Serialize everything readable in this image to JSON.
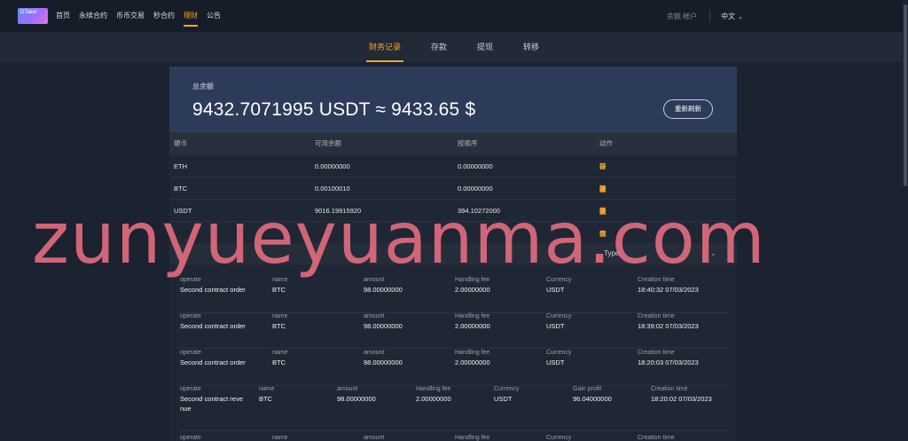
{
  "nav": {
    "logo": "DTaker",
    "links": [
      "首页",
      "永续合约",
      "币币交易",
      "秒合约",
      "理财",
      "公告"
    ],
    "account": "余额 帐户",
    "language": "中文"
  },
  "subtabs": [
    "财务记录",
    "存款",
    "提现",
    "转移"
  ],
  "balance": {
    "label": "总余额",
    "value": "9432.7071995 USDT ≈ 9433.65 $",
    "refresh": "重新刷新"
  },
  "assets": {
    "headers": [
      "硬币",
      "可用余额",
      "按顺序",
      "动作"
    ],
    "rows": [
      {
        "coin": "ETH",
        "available": "0.00000000",
        "in_order": "0.00000000"
      },
      {
        "coin": "BTC",
        "available": "0.00100010",
        "in_order": "0.00000000"
      },
      {
        "coin": "USDT",
        "available": "9016.19915920",
        "in_order": "394.10272000"
      }
    ],
    "actions": [
      "提现",
      "存款",
      "转移"
    ]
  },
  "filter": {
    "type_label": "Type"
  },
  "records_labels": {
    "operate": "operate",
    "name": "name",
    "amount": "amount",
    "fee": "Handling fee",
    "currency": "Currency",
    "profit": "Gain profit",
    "time": "Creation time"
  },
  "records": [
    {
      "operate": "Second contract order",
      "name": "BTC",
      "amount": "98.00000000",
      "fee": "2.00000000",
      "currency": "USDT",
      "time": "18:40:32 07/03/2023"
    },
    {
      "operate": "Second contract order",
      "name": "BTC",
      "amount": "98.00000000",
      "fee": "2.00000000",
      "currency": "USDT",
      "time": "18:39:02 07/03/2023"
    },
    {
      "operate": "Second contract order",
      "name": "BTC",
      "amount": "98.00000000",
      "fee": "2.00000000",
      "currency": "USDT",
      "time": "18:20:03 07/03/2023"
    },
    {
      "operate_line1": "Second contract reve",
      "operate_line2": "nue",
      "name": "BTC",
      "amount": "98.00000000",
      "fee": "2.00000000",
      "currency": "USDT",
      "profit": "96.04000000",
      "time": "18:20:02 07/03/2023"
    }
  ],
  "watermark": "zunyueyuanma.com"
}
